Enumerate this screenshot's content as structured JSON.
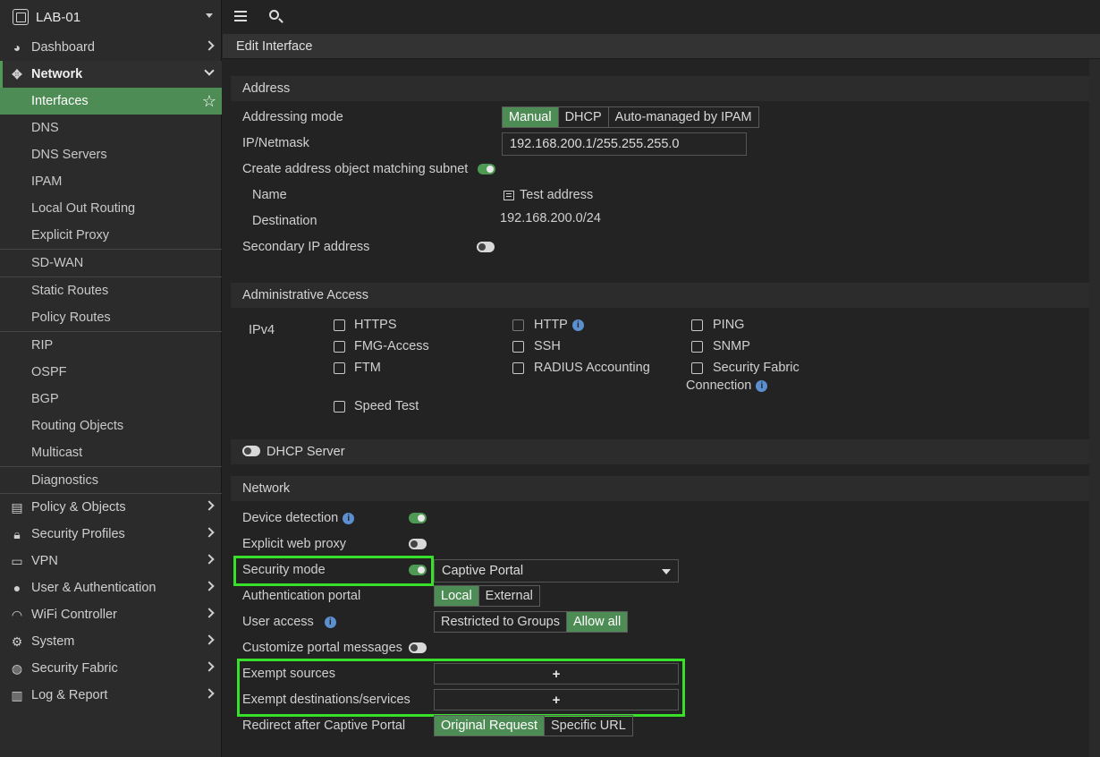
{
  "device": {
    "name": "LAB-01"
  },
  "topbar": {
    "menu_icon": "hamburger-icon",
    "search_icon": "search-icon"
  },
  "sidebar": {
    "dashboard": "Dashboard",
    "network": "Network",
    "sub": [
      "Interfaces",
      "DNS",
      "DNS Servers",
      "IPAM",
      "Local Out Routing",
      "Explicit Proxy",
      "SD-WAN",
      "Static Routes",
      "Policy Routes",
      "RIP",
      "OSPF",
      "BGP",
      "Routing Objects",
      "Multicast",
      "Diagnostics"
    ],
    "items": [
      "Policy & Objects",
      "Security Profiles",
      "VPN",
      "User & Authentication",
      "WiFi Controller",
      "System",
      "Security Fabric",
      "Log & Report"
    ]
  },
  "header": {
    "title": "Edit Interface"
  },
  "address": {
    "section": "Address",
    "addressing_mode_label": "Addressing mode",
    "modes": [
      "Manual",
      "DHCP",
      "Auto-managed by IPAM"
    ],
    "ip_label": "IP/Netmask",
    "ip_value": "192.168.200.1/255.255.255.0",
    "create_obj_label": "Create address object matching subnet",
    "name_label": "Name",
    "name_value": "Test address",
    "dest_label": "Destination",
    "dest_value": "192.168.200.0/24",
    "secondary_label": "Secondary IP address"
  },
  "admin": {
    "section": "Administrative Access",
    "ipv4": "IPv4",
    "col1": [
      "HTTPS",
      "FMG-Access",
      "FTM"
    ],
    "col2": [
      "HTTP",
      "SSH",
      "RADIUS Accounting"
    ],
    "col3": [
      "PING",
      "SNMP",
      "Security Fabric"
    ],
    "connection": "Connection",
    "speed_test": "Speed Test"
  },
  "dhcp": {
    "label": "DHCP Server"
  },
  "network": {
    "section": "Network",
    "device_detection": "Device detection",
    "explicit_proxy": "Explicit web proxy",
    "security_mode": "Security mode",
    "security_mode_value": "Captive Portal",
    "auth_portal": "Authentication portal",
    "auth_options": [
      "Local",
      "External"
    ],
    "user_access": "User access",
    "user_access_options": [
      "Restricted to Groups",
      "Allow all"
    ],
    "customize": "Customize portal messages",
    "exempt_sources": "Exempt sources",
    "exempt_dest": "Exempt destinations/services",
    "plus": "+",
    "redirect": "Redirect after Captive Portal",
    "redirect_options": [
      "Original Request",
      "Specific URL"
    ]
  },
  "colors": {
    "accent": "#4e8c55",
    "highlight": "#39e02a",
    "info": "#5b8fcf"
  }
}
